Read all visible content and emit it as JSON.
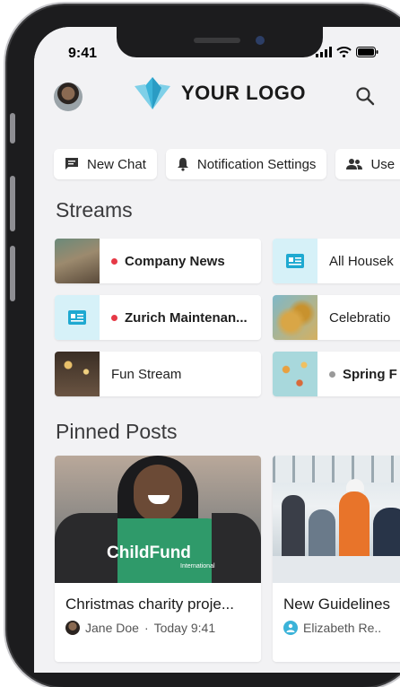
{
  "status_bar": {
    "time": "9:41"
  },
  "header": {
    "logo_text": "YOUR LOGO"
  },
  "chips": [
    {
      "label": "New Chat",
      "icon": "chat-icon"
    },
    {
      "label": "Notification Settings",
      "icon": "bell-icon"
    },
    {
      "label": "Use",
      "icon": "users-icon"
    }
  ],
  "streams": {
    "title": "Streams",
    "items": [
      {
        "label": "Company News",
        "unread": true
      },
      {
        "label": "Zurich Maintenan...",
        "unread": true
      },
      {
        "label": "Fun Stream",
        "unread": false
      },
      {
        "label": "All Housek",
        "unread": false
      },
      {
        "label": "Celebratio",
        "unread": false
      },
      {
        "label": "Spring F",
        "unread": true
      }
    ]
  },
  "pinned": {
    "title": "Pinned Posts",
    "posts": [
      {
        "title": "Christmas charity proje...",
        "author": "Jane Doe",
        "time": "Today 9:41",
        "separator": "·",
        "image_text": "ChildFund",
        "image_subtext": "International"
      },
      {
        "title": "New Guidelines",
        "author": "Elizabeth Re..",
        "time": "",
        "separator": ""
      }
    ]
  },
  "colors": {
    "accent": "#3bb3d9",
    "unread_dot": "#e63946",
    "grey_dot": "#9a9a9a",
    "background": "#f2f2f4"
  }
}
